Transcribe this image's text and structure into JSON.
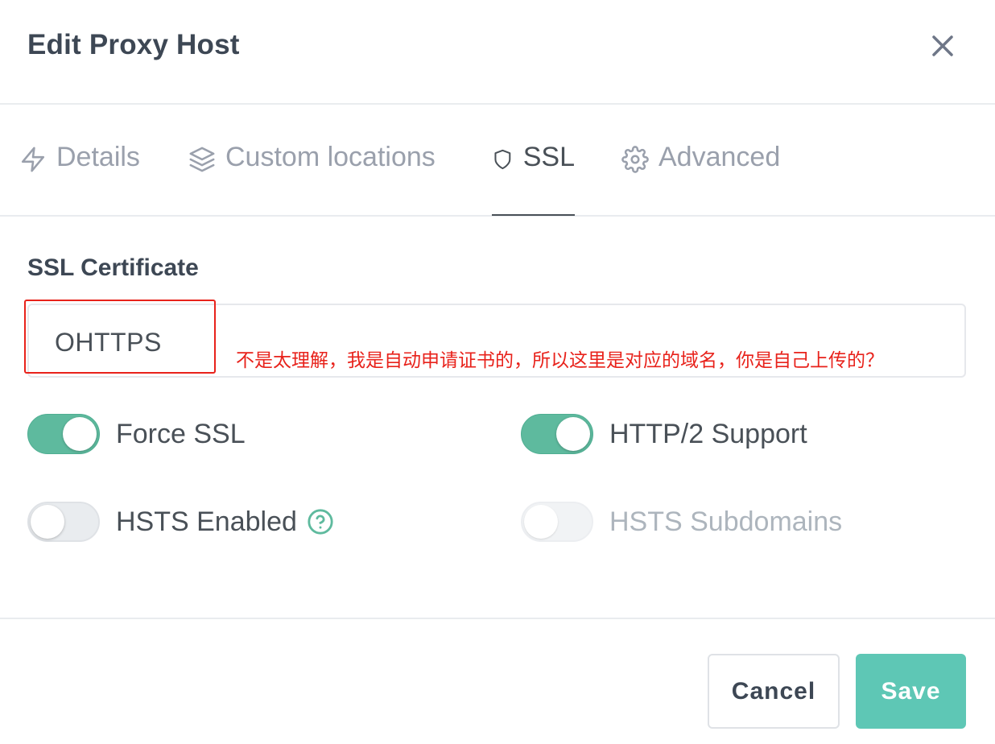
{
  "modal": {
    "title": "Edit Proxy Host",
    "close_icon": "close-icon"
  },
  "tabs": [
    {
      "label": "Details",
      "icon": "zap-icon",
      "active": false
    },
    {
      "label": "Custom locations",
      "icon": "layers-icon",
      "active": false
    },
    {
      "label": "SSL",
      "icon": "shield-icon",
      "active": true
    },
    {
      "label": "Advanced",
      "icon": "settings-icon",
      "active": false
    }
  ],
  "ssl": {
    "section_label": "SSL Certificate",
    "certificate_value": "OHTTPS",
    "annotation": "不是太理解，我是自动申请证书的，所以这里是对应的域名，你是自己上传的？",
    "toggles": [
      {
        "label": "Force SSL",
        "state": "on"
      },
      {
        "label": "HTTP/2 Support",
        "state": "on"
      },
      {
        "label": "HSTS Enabled",
        "state": "off",
        "help_icon": "help-circle-icon"
      },
      {
        "label": "HSTS Subdomains",
        "state": "disabled"
      }
    ]
  },
  "footer": {
    "cancel_label": "Cancel",
    "save_label": "Save"
  },
  "colors": {
    "accent_teal": "#5eba9e",
    "save_button": "#5ec7b5",
    "annotation_red": "#e8221b",
    "title_text": "#3d4754",
    "muted_tab": "#9aa0ac"
  }
}
